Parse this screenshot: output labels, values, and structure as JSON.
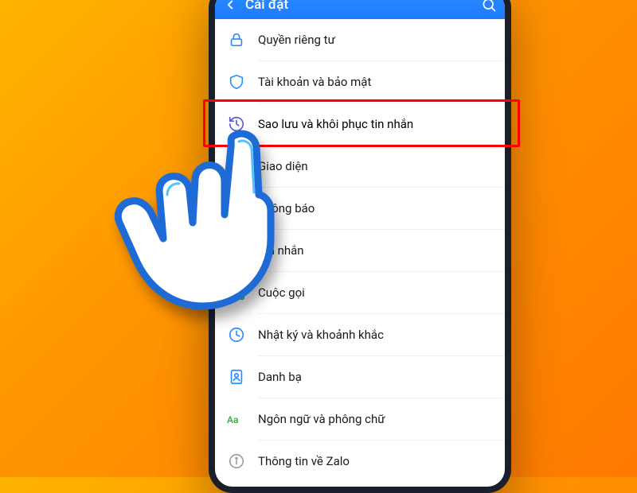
{
  "header": {
    "title": "Cài đặt"
  },
  "rows": [
    {
      "icon": "lock-icon",
      "label": "Quyền riêng tư"
    },
    {
      "icon": "shield-icon",
      "label": "Tài khoản và bảo mật"
    },
    {
      "icon": "history-icon",
      "label": "Sao lưu và khôi phục tin nhắn",
      "highlighted": true
    },
    {
      "icon": "palette-icon",
      "label": "Giao diện"
    },
    {
      "icon": "bell-icon",
      "label": "Thông báo"
    },
    {
      "icon": "chat-icon",
      "label": "Tin nhắn"
    },
    {
      "icon": "phone-icon",
      "label": "Cuộc gọi"
    },
    {
      "icon": "clock-icon",
      "label": "Nhật ký và khoảnh khắc"
    },
    {
      "icon": "contacts-icon",
      "label": "Danh bạ"
    },
    {
      "icon": "font-icon",
      "label": "Ngôn ngữ và phông chữ"
    },
    {
      "icon": "info-icon",
      "label": "Thông tin về Zalo"
    }
  ],
  "colors": {
    "header_bg": "#2a8cff",
    "icon_default": "#2a8cff",
    "icon_highlight": "#5b5bd6",
    "highlight_border": "#ff0000",
    "font_icon_color": "#3cb043"
  }
}
